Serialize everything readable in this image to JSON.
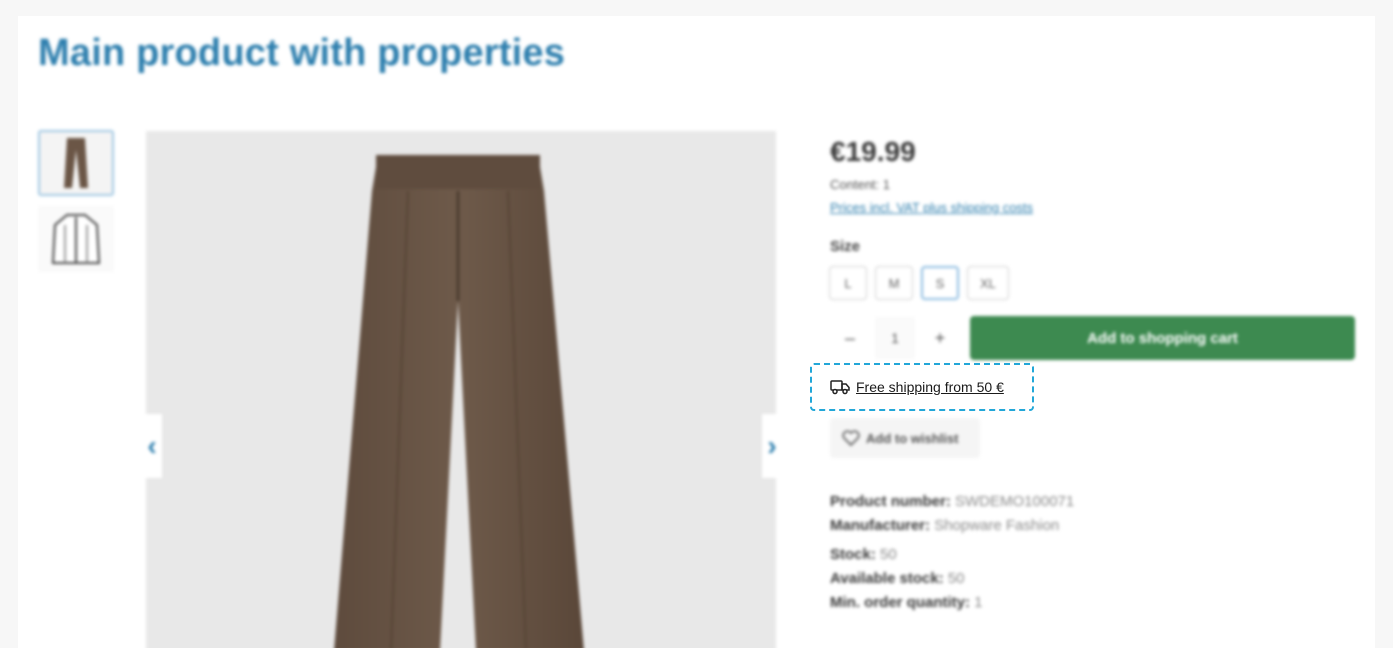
{
  "page": {
    "title": "Main product with properties"
  },
  "gallery": {
    "thumbnails": [
      {
        "icon": "trousers-thumbnail-icon"
      },
      {
        "icon": "jacket-thumbnail-icon"
      }
    ],
    "main_image_icon": "trousers-product-icon",
    "prev_glyph": "‹",
    "next_glyph": "›"
  },
  "buybox": {
    "price": "€19.99",
    "content": "Content: 1",
    "prices_link": "Prices incl. VAT plus shipping costs",
    "size_label": "Size",
    "sizes": [
      "L",
      "M",
      "S",
      "XL"
    ],
    "selected_size": "S",
    "quantity": {
      "minus": "–",
      "value": "1",
      "plus": "+"
    },
    "add_to_cart": "Add to shopping cart",
    "free_shipping": "Free shipping from 50 €",
    "wishlist": "Add to wishlist"
  },
  "details": {
    "product_number_label": "Product number:",
    "product_number": "SWDEMO100071",
    "manufacturer_label": "Manufacturer:",
    "manufacturer": "Shopware Fashion",
    "stock_label": "Stock:",
    "stock": "50",
    "available_stock_label": "Available stock:",
    "available_stock": "50",
    "min_order_label": "Min. order quantity:",
    "min_order": "1"
  },
  "colors": {
    "accent": "#2e7fae",
    "cart_button": "#3d8a50",
    "highlight_border": "#22a7d8"
  }
}
